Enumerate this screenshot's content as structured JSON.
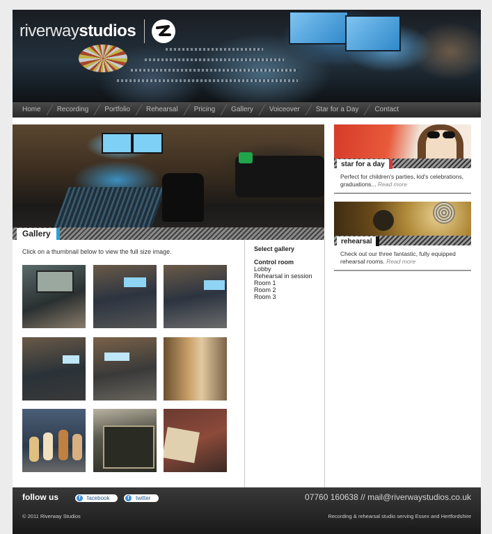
{
  "brand": {
    "name_light": "riverway",
    "name_bold": "studios"
  },
  "nav": {
    "items": [
      "Home",
      "Recording",
      "Portfolio",
      "Rehearsal",
      "Pricing",
      "Gallery",
      "Voiceover",
      "Star for a Day",
      "Contact"
    ]
  },
  "gallery": {
    "caption": "Gallery",
    "intro": "Click on a thumbnail below to view the full size image.",
    "select_heading": "Select gallery",
    "items": [
      "Control room",
      "Lobby",
      "Rehearsal in session",
      "Room 1",
      "Room 2",
      "Room 3"
    ],
    "active": "Control room"
  },
  "sidebar": {
    "promo1": {
      "label": "star for a day",
      "text": "Perfect for children's parties, kid's celebrations, graduations... ",
      "readmore": "Read more"
    },
    "promo2": {
      "label": "rehearsal",
      "text": "Check out our three fantastic, fully equipped rehearsal rooms. ",
      "readmore": "Read more"
    }
  },
  "footer": {
    "follow": "follow us",
    "facebook": "facebook",
    "twitter": "twitter",
    "contact": "07760 160638 // mail@riverwaystudios.co.uk",
    "copyright": "© 2011 Riverway Studios",
    "tagline": "Recording & rehearsal studio serving Essex and Hertfordshire"
  },
  "colors": {
    "accent_blue": "#2aa0d8",
    "accent_red": "#d83a3a"
  }
}
